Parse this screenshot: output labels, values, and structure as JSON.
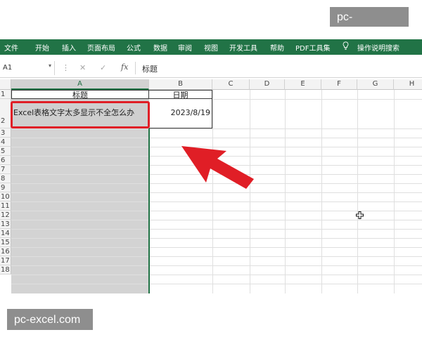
{
  "watermark": {
    "top": "pc-excel.com",
    "bottom": "pc-excel.com"
  },
  "ribbon": {
    "tabs": [
      "文件",
      "开始",
      "插入",
      "页面布局",
      "公式",
      "数据",
      "审阅",
      "视图",
      "开发工具",
      "帮助",
      "PDF工具集"
    ],
    "search": "操作说明搜索",
    "search_icon": "lightbulb-icon"
  },
  "formula_bar": {
    "name_box": "A1",
    "cancel_icon": "cancel-icon",
    "enter_icon": "checkmark-icon",
    "fx": "fx",
    "content": "标题"
  },
  "sheet": {
    "columns": [
      "A",
      "B",
      "C",
      "D",
      "E",
      "F",
      "G",
      "H"
    ],
    "rows": [
      "1",
      "2",
      "3",
      "4",
      "5",
      "6",
      "7",
      "8",
      "9",
      "10",
      "11",
      "12",
      "13",
      "14",
      "15",
      "16",
      "17",
      "18"
    ],
    "selected_column": "A",
    "cells": {
      "A1": "标题",
      "B1": "日期",
      "A2": "Excel表格文字太多显示不全怎么办",
      "B2": "2023/8/19"
    }
  },
  "annotation": {
    "arrow_color": "#e01e26",
    "highlight_color": "#e01e26"
  },
  "colors": {
    "ribbon": "#217346",
    "selected_column": "#d3d3d3"
  }
}
